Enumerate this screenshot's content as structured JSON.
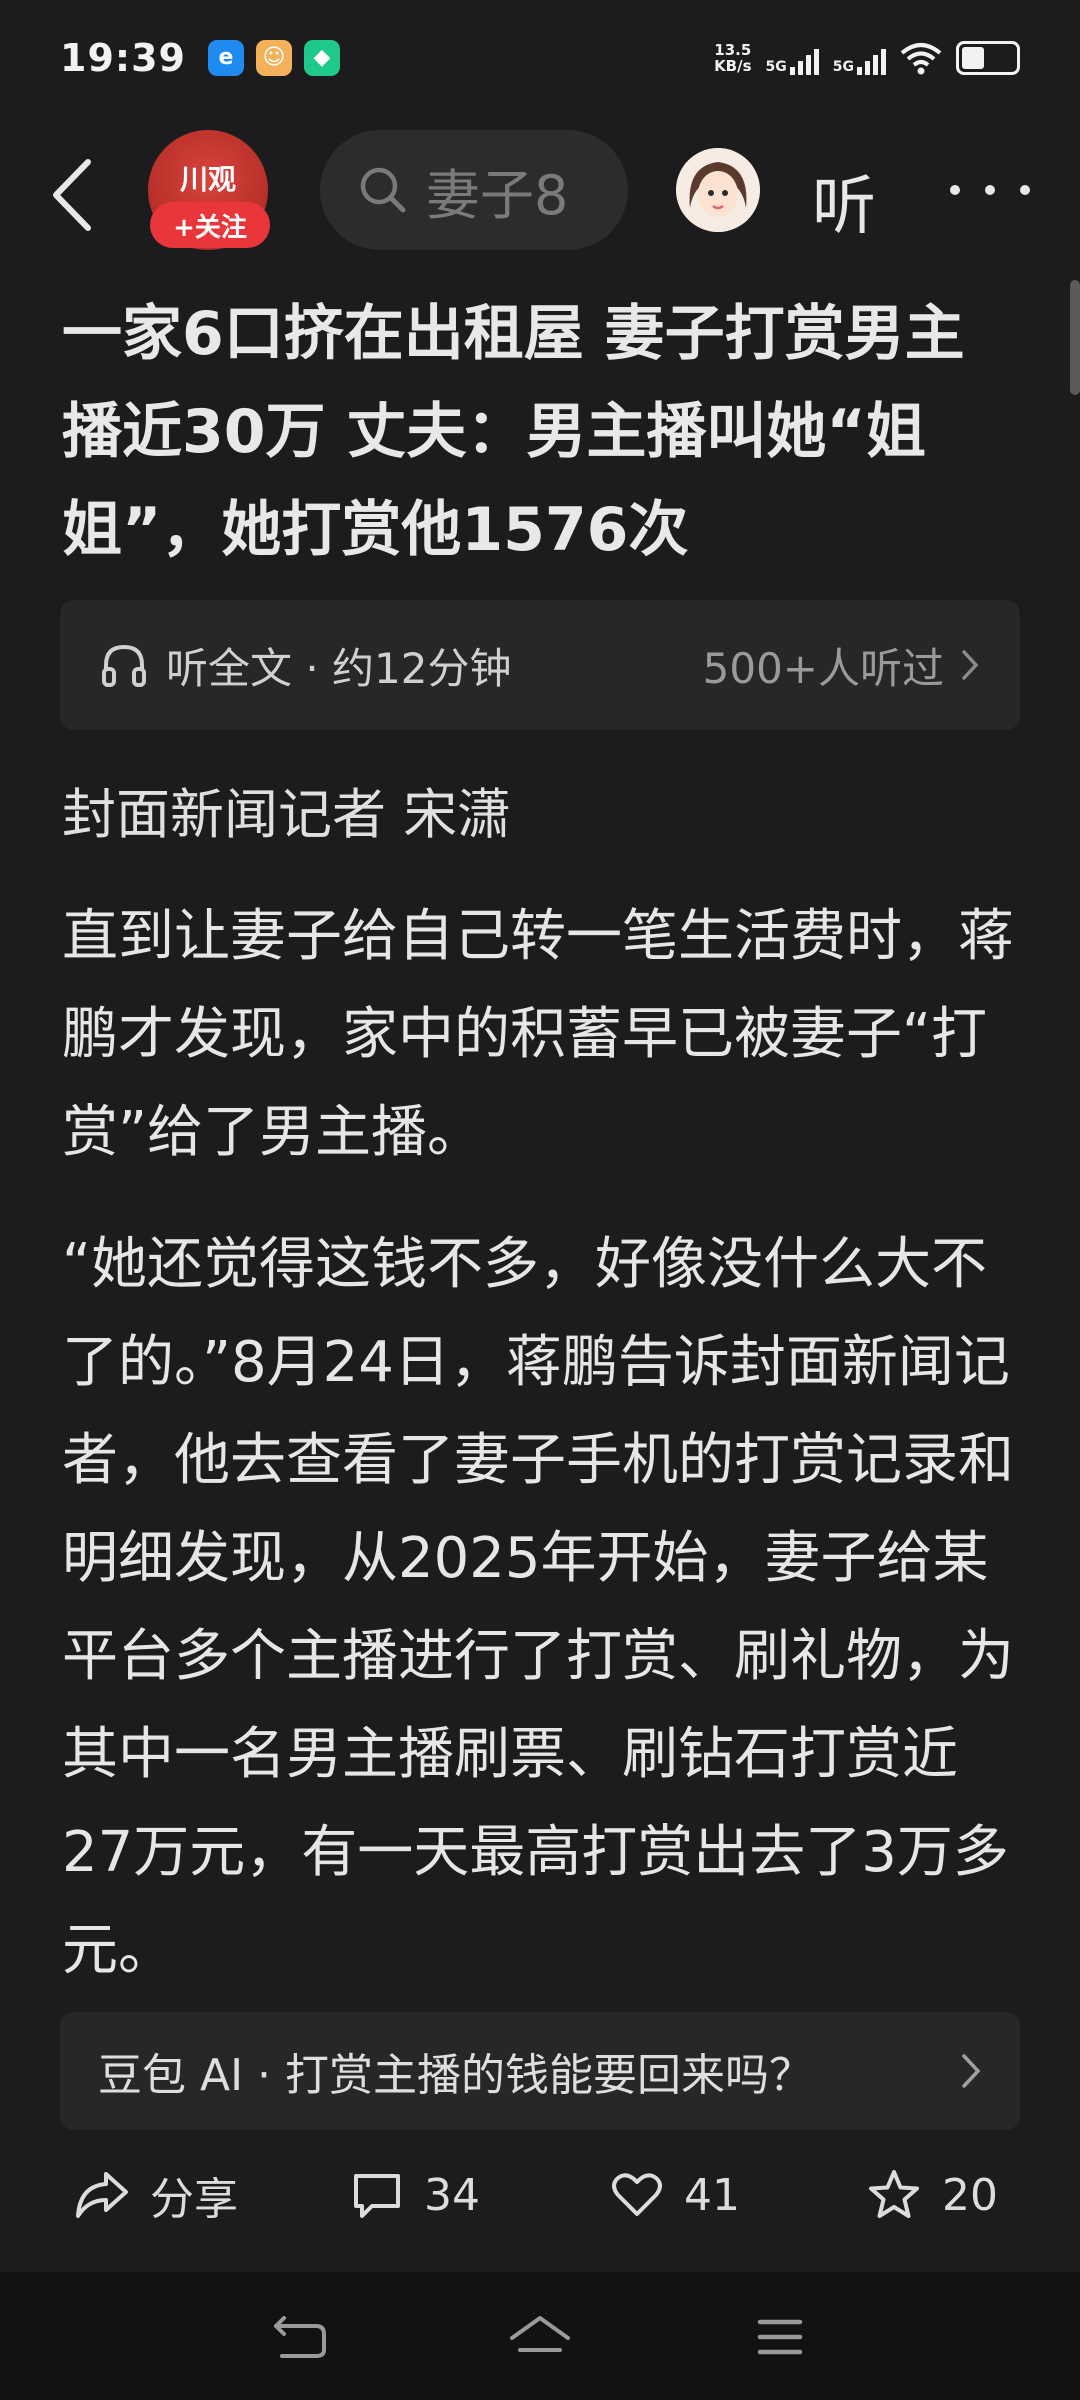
{
  "status_bar": {
    "time": "19:39",
    "net_speed_value": "13.5",
    "net_speed_unit": "KB/s",
    "sim1": "5G",
    "sim2": "5G",
    "apps": [
      "e",
      "☺",
      "◆"
    ]
  },
  "nav": {
    "channel_name": "川观",
    "follow_label": "+关注",
    "search_placeholder": "妻子8",
    "listen_label": "听",
    "icons": [
      "back-icon",
      "search-icon",
      "more-icon"
    ]
  },
  "article": {
    "title": "一家6口挤在出租屋 妻子打赏男主播近30万 丈夫：男主播叫她“姐姐”，她打赏他1576次",
    "listen_bar": {
      "label": "听全文 · 约12分钟",
      "count": "500+人听过"
    },
    "byline": "封面新闻记者 宋潇",
    "paragraphs": [
      "直到让妻子给自己转一笔生活费时，蒋鹏才发现，家中的积蓄早已被妻子“打赏”给了男主播。",
      "“她还觉得这钱不多，好像没什么大不了的。”8月24日，蒋鹏告诉封面新闻记者，他去查看了妻子手机的打赏记录和明细发现，从2025年开始，妻子给某平台多个主播进行了打赏、刷礼物，为其中一名男主播刷票、刷钻石打赏近27万元，有一天最高打赏出去了3万多元。"
    ]
  },
  "ai_prompt": "豆包 AI · 打赏主播的钱能要回来吗？",
  "actions": {
    "share_label": "分享",
    "comment_count": "34",
    "like_count": "41",
    "favorite_count": "20"
  },
  "colors": {
    "background": "#1c1c1e",
    "card": "#27272a",
    "accent_red": "#e8363a"
  }
}
